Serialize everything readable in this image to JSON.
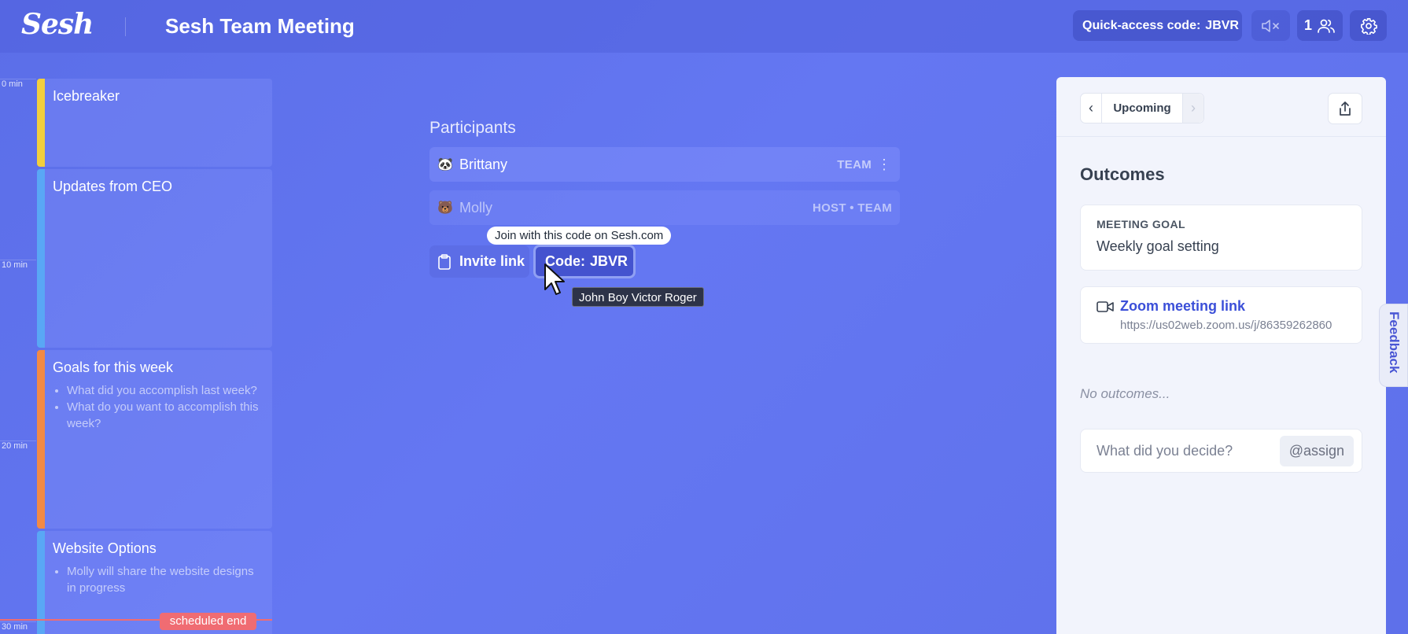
{
  "header": {
    "logo": "Sesh",
    "meeting_title": "Sesh Team Meeting",
    "quick_access_label": "Quick-access code:",
    "quick_access_code": "JBVR",
    "participant_count": "1"
  },
  "timeline": {
    "ticks": [
      "0 min",
      "10 min",
      "20 min",
      "30 min"
    ],
    "agenda": [
      {
        "title": "Icebreaker",
        "color": "#f2cf3d",
        "bullets": []
      },
      {
        "title": "Updates from CEO",
        "color": "#59a7f5",
        "bullets": []
      },
      {
        "title": "Goals for this week",
        "color": "#f28a45",
        "bullets": [
          "What did you accomplish last week?",
          "What do you want to accomplish this week?"
        ]
      },
      {
        "title": "Website Options",
        "color": "#59a7f5",
        "bullets": [
          "Molly will share the website designs in progress"
        ]
      }
    ],
    "scheduled_end_label": "scheduled end"
  },
  "participants": {
    "heading": "Participants",
    "list": [
      {
        "avatar": "🐼",
        "name": "Brittany",
        "role": "TEAM"
      },
      {
        "avatar": "🐻",
        "name": "Molly",
        "role": "HOST • TEAM"
      }
    ],
    "invite_label": "Invite link",
    "code_label": "Code:",
    "code_value": "JBVR",
    "tooltip_join": "Join with this code on Sesh.com",
    "tooltip_code": "John Boy Victor Roger"
  },
  "panel": {
    "nav_label": "Upcoming",
    "outcomes_title": "Outcomes",
    "goal_label": "MEETING GOAL",
    "goal_value": "Weekly goal setting",
    "zoom_label": "Zoom meeting link",
    "zoom_url": "https://us02web.zoom.us/j/86359262860",
    "no_outcomes": "No outcomes...",
    "decide_placeholder": "What did you decide?",
    "assign_label": "@assign",
    "feedback_label": "Feedback"
  },
  "colors": {
    "accent": "#4453cf",
    "scheduled_end": "#f06c72",
    "link": "#3b4fd8"
  },
  "icons": [
    "clipboard-icon",
    "mute-icon",
    "people-icon",
    "gear-icon",
    "chevron-left-icon",
    "chevron-right-icon",
    "share-icon",
    "video-camera-icon",
    "kebab-menu-icon",
    "cursor-pointer-icon"
  ]
}
